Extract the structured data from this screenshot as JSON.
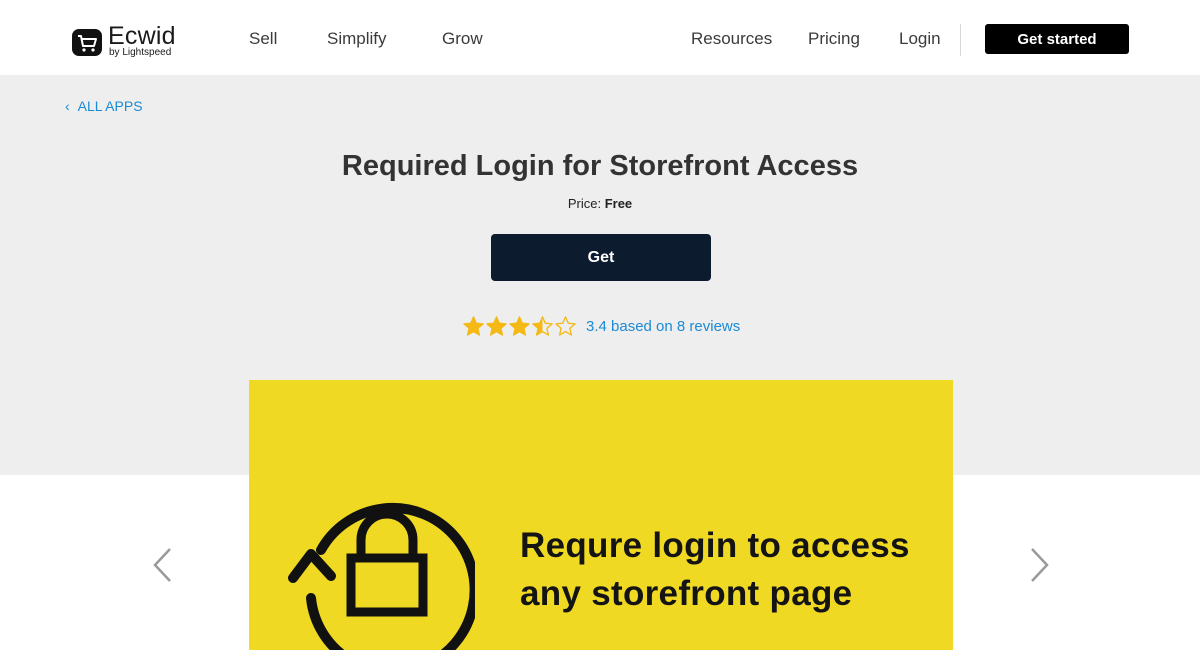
{
  "header": {
    "logo": {
      "name": "Ecwid",
      "sub": "by Lightspeed"
    },
    "nav_left": [
      "Sell",
      "Simplify",
      "Grow"
    ],
    "nav_right": [
      "Resources",
      "Pricing",
      "Login"
    ],
    "cta_label": "Get started"
  },
  "hero": {
    "back_label": "ALL APPS",
    "title": "Required Login for Storefront Access",
    "price_label": "Price:",
    "price_value": "Free",
    "get_label": "Get",
    "rating_value": 3.4,
    "rating_text": "3.4 based on 8 reviews"
  },
  "banner": {
    "line1": "Requre login to access",
    "line2": "any storefront page",
    "bg_color": "#f0d923"
  },
  "colors": {
    "accent": "#1b8ad6",
    "star": "#f5b916",
    "button_dark": "#0d1b2e"
  },
  "icons": [
    "shopping-cart-logo-icon",
    "chevron-left-icon",
    "star-icon",
    "lock-refresh-icon",
    "chevron-right-icon"
  ]
}
